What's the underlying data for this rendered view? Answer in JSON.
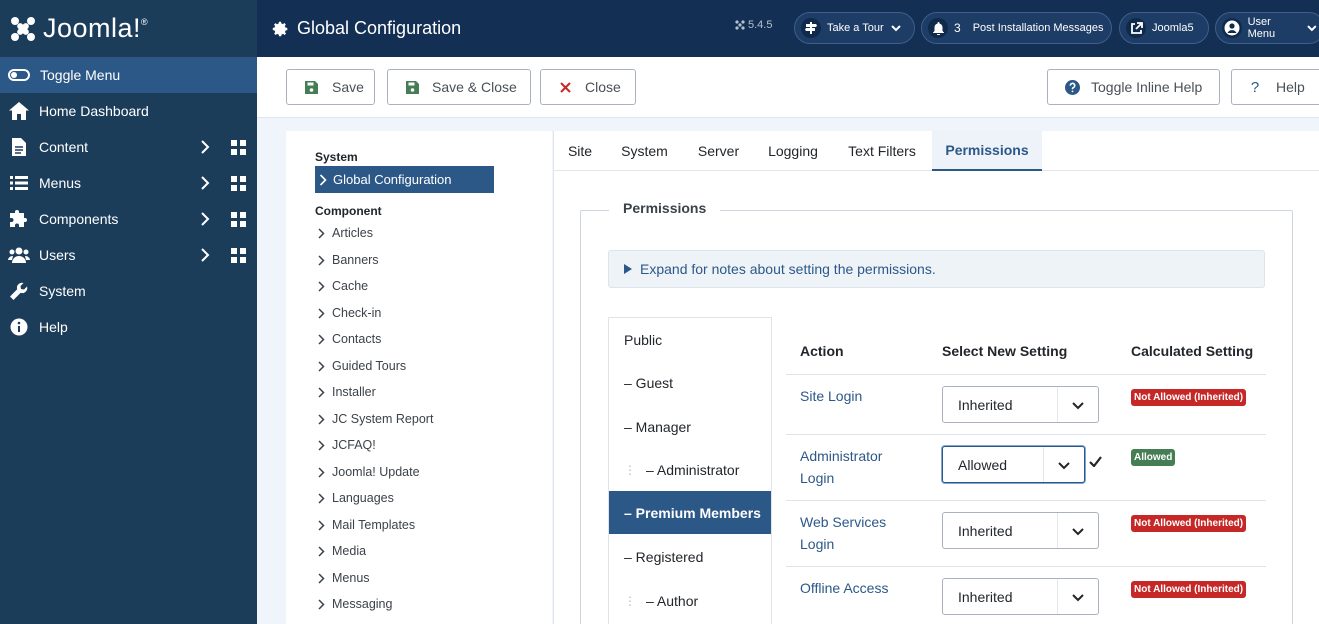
{
  "brand": {
    "name": "Joomla!"
  },
  "header": {
    "title": "Global Configuration",
    "version": "5.4.5",
    "take_tour": "Take a Tour",
    "messages_count": "3",
    "messages_label": "Post Installation Messages",
    "site_link": "Joomla5",
    "user_menu": "User Menu"
  },
  "sidebar": {
    "toggle": "Toggle Menu",
    "items": [
      {
        "label": "Home Dashboard",
        "icon": "home-icon"
      },
      {
        "label": "Content",
        "icon": "file-icon"
      },
      {
        "label": "Menus",
        "icon": "list-icon"
      },
      {
        "label": "Components",
        "icon": "puzzle-icon"
      },
      {
        "label": "Users",
        "icon": "users-icon"
      },
      {
        "label": "System",
        "icon": "wrench-icon"
      },
      {
        "label": "Help",
        "icon": "info-icon"
      }
    ]
  },
  "toolbar": {
    "save": "Save",
    "save_close": "Save & Close",
    "close": "Close",
    "toggle_help": "Toggle Inline Help",
    "help": "Help"
  },
  "leftnav": {
    "system_heading": "System",
    "active": "Global Configuration",
    "component_heading": "Component",
    "components": [
      "Articles",
      "Banners",
      "Cache",
      "Check-in",
      "Contacts",
      "Guided Tours",
      "Installer",
      "JC System Report",
      "JCFAQ!",
      "Joomla! Update",
      "Languages",
      "Mail Templates",
      "Media",
      "Menus",
      "Messaging"
    ]
  },
  "tabs": [
    "Site",
    "System",
    "Server",
    "Logging",
    "Text Filters",
    "Permissions"
  ],
  "permissions": {
    "legend": "Permissions",
    "notes": "Expand for notes about setting the permissions.",
    "groups": [
      "Public",
      "– Guest",
      "– Manager",
      "– Administrator",
      "– Premium Members",
      "– Registered",
      "– Author"
    ],
    "headers": {
      "action": "Action",
      "select": "Select New Setting",
      "calculated": "Calculated Setting"
    },
    "rows": [
      {
        "action": "Site Login",
        "setting": "Inherited",
        "calculated": "Not Allowed (Inherited)"
      },
      {
        "action": "Administrator Login",
        "setting": "Allowed",
        "calculated": "Allowed"
      },
      {
        "action": "Web Services Login",
        "setting": "Inherited",
        "calculated": "Not Allowed (Inherited)"
      },
      {
        "action": "Offline Access",
        "setting": "Inherited",
        "calculated": "Not Allowed (Inherited)"
      }
    ]
  }
}
